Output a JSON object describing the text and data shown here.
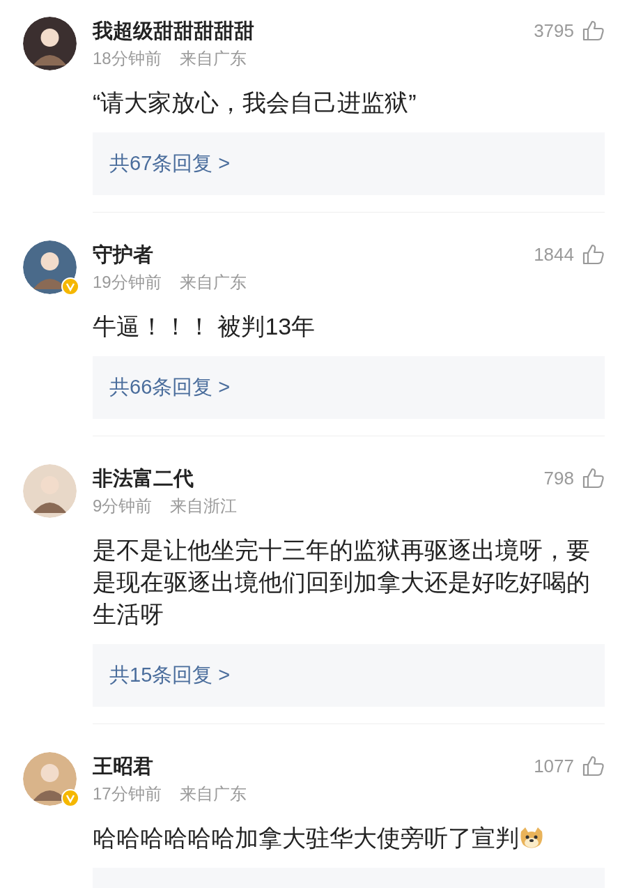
{
  "comments": [
    {
      "name": "我超级甜甜甜甜甜",
      "time": "18分钟前",
      "location": "来自广东",
      "likes": "3795",
      "verified": false,
      "text": "“请大家放心，我会自己进监狱”",
      "emoji": false,
      "replies": "共67条回复 >"
    },
    {
      "name": "守护者",
      "time": "19分钟前",
      "location": "来自广东",
      "likes": "1844",
      "verified": true,
      "text": "牛逼！！！ 被判13年",
      "emoji": false,
      "replies": "共66条回复 >"
    },
    {
      "name": "非法富二代",
      "time": "9分钟前",
      "location": "来自浙江",
      "likes": "798",
      "verified": false,
      "text": "是不是让他坐完十三年的监狱再驱逐出境呀，要是现在驱逐出境他们回到加拿大还是好吃好喝的生活呀",
      "emoji": false,
      "replies": "共15条回复 >"
    },
    {
      "name": "王昭君",
      "time": "17分钟前",
      "location": "来自广东",
      "likes": "1077",
      "verified": true,
      "text": "哈哈哈哈哈哈加拿大驻华大使旁听了宣判",
      "emoji": true
    }
  ]
}
